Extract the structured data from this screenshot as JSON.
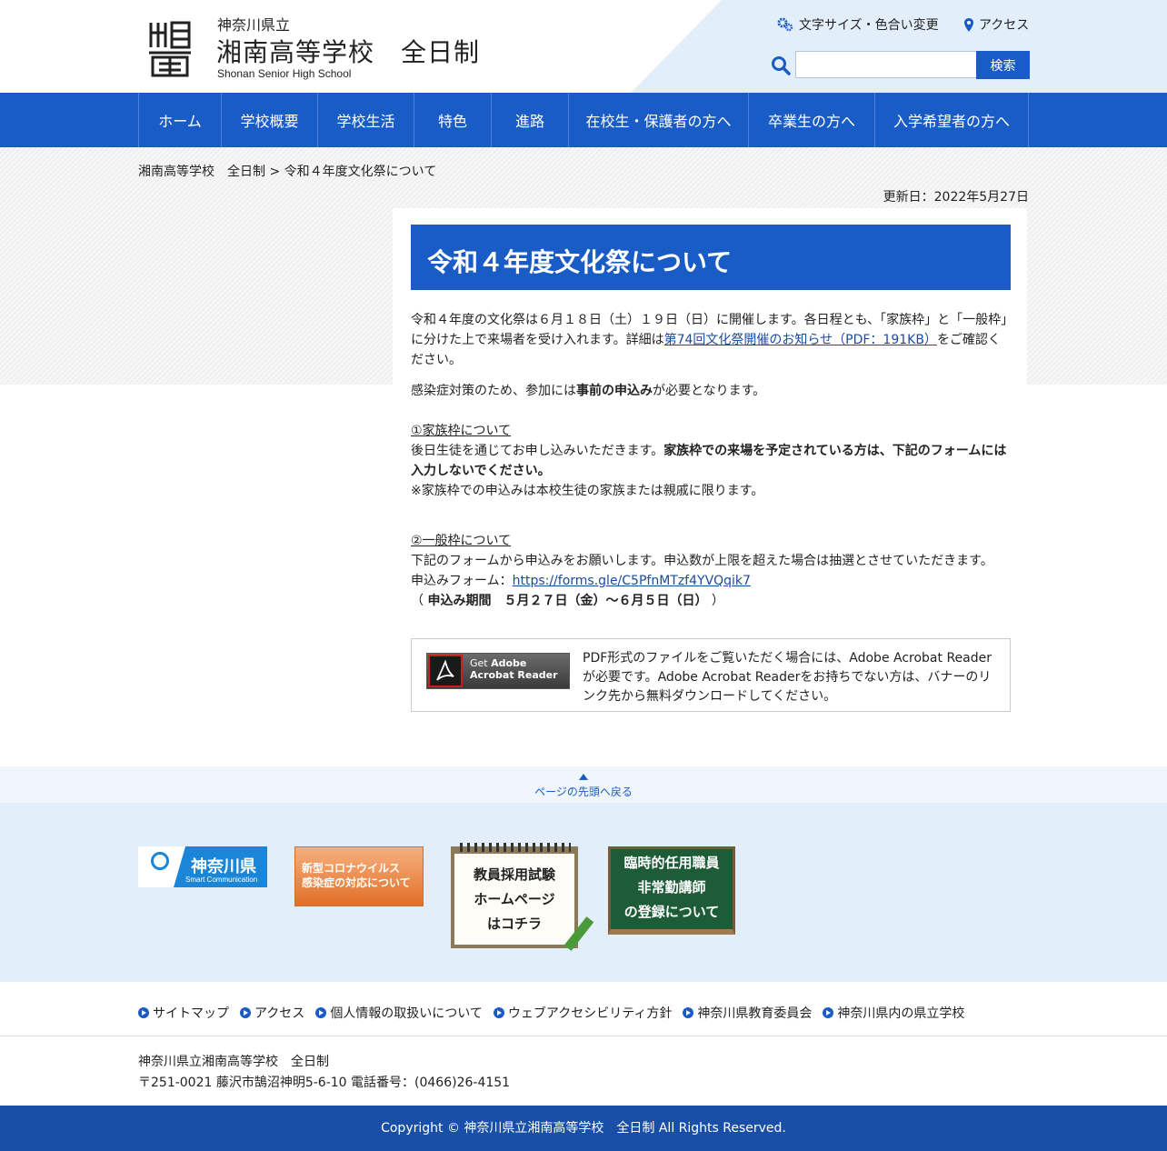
{
  "header": {
    "prefecture": "神奈川県立",
    "school_name": "湘南高等学校　全日制",
    "school_name_en": "Shonan Senior High School",
    "text_size_link": "文字サイズ・色合い変更",
    "access_link": "アクセス",
    "search_placeholder": "",
    "search_button": "検索",
    "logo_icon": "shonan-logo-icon"
  },
  "nav": {
    "items": [
      "ホーム",
      "学校概要",
      "学校生活",
      "特色",
      "進路",
      "在校生・保護者の方へ",
      "卒業生の方へ",
      "入学希望者の方へ"
    ]
  },
  "breadcrumb": {
    "home": "湘南高等学校　全日制",
    "sep": " > ",
    "current": "令和４年度文化祭について"
  },
  "updated": "更新日：2022年5月27日",
  "article": {
    "title": "令和４年度文化祭について",
    "p1_a": "令和４年度の文化祭は６月１８日（土）１９日（日）に開催します。各日程とも、「家族枠」と「一般枠」に分けた上で来場者を受け入れます。詳細は",
    "p1_link": "第74回文化祭開催のお知らせ（PDF：191KB）",
    "p1_b": "をご確認ください。",
    "p2_a": "感染症対策のため、参加には",
    "p2_bold": "事前の申込み",
    "p2_b": "が必要となります。",
    "family_heading": "①家族枠について",
    "family_a": "後日生徒を通じてお申し込みいただきます。",
    "family_bold": "家族枠での来場を予定されている方は、下記のフォームには入力しないでください。",
    "family_note": "※家族枠での申込みは本校生徒の家族または親戚に限ります。",
    "general_heading": "②一般枠について",
    "general_text": "下記のフォームから申込みをお願いします。申込数が上限を超えた場合は抽選とさせていただきます。",
    "form_label": "申込みフォーム：",
    "form_link": "https://forms.gle/C5PfnMTzf4YVQqik7",
    "period_open": "（ ",
    "period_bold": "申込み期間　５月２７日（金）～６月５日（日）",
    "period_close": " ）"
  },
  "acrobat": {
    "banner_line1a": "Get ",
    "banner_line1b": "Adobe",
    "banner_line2": "Acrobat Reader",
    "description": "PDF形式のファイルをご覧いただく場合には、Adobe Acrobat Readerが必要です。Adobe Acrobat Readerをお持ちでない方は、バナーのリンク先から無料ダウンロードしてください。"
  },
  "pagetop": "ページの先頭へ戻る",
  "banners": {
    "kanagawa": "神奈川県",
    "kanagawa_sub": "Smart Communication",
    "corona_1": "新型コロナウイルス",
    "corona_2": "感染症の対応について",
    "exam_1": "教員採用試験",
    "exam_2": "ホームページ",
    "exam_3": "はコチラ",
    "board_1": "臨時的任用職員",
    "board_2": "非常勤講師",
    "board_3": "の登録について"
  },
  "footer": {
    "links": [
      "サイトマップ",
      "アクセス",
      "個人情報の取扱いについて",
      "ウェブアクセシビリティ方針",
      "神奈川県教育委員会",
      "神奈川県内の県立学校"
    ],
    "address_1": "神奈川県立湘南高等学校　全日制",
    "address_2": "〒251-0021 藤沢市鵠沼神明5-6-10 電話番号：(0466)26-4151",
    "copyright": "Copyright © 神奈川県立湘南高等学校　全日制 All Rights Reserved."
  },
  "colors": {
    "primary": "#1a5cc6",
    "footer_bar": "#1a4fa8",
    "light_bg": "#e3eefb"
  }
}
